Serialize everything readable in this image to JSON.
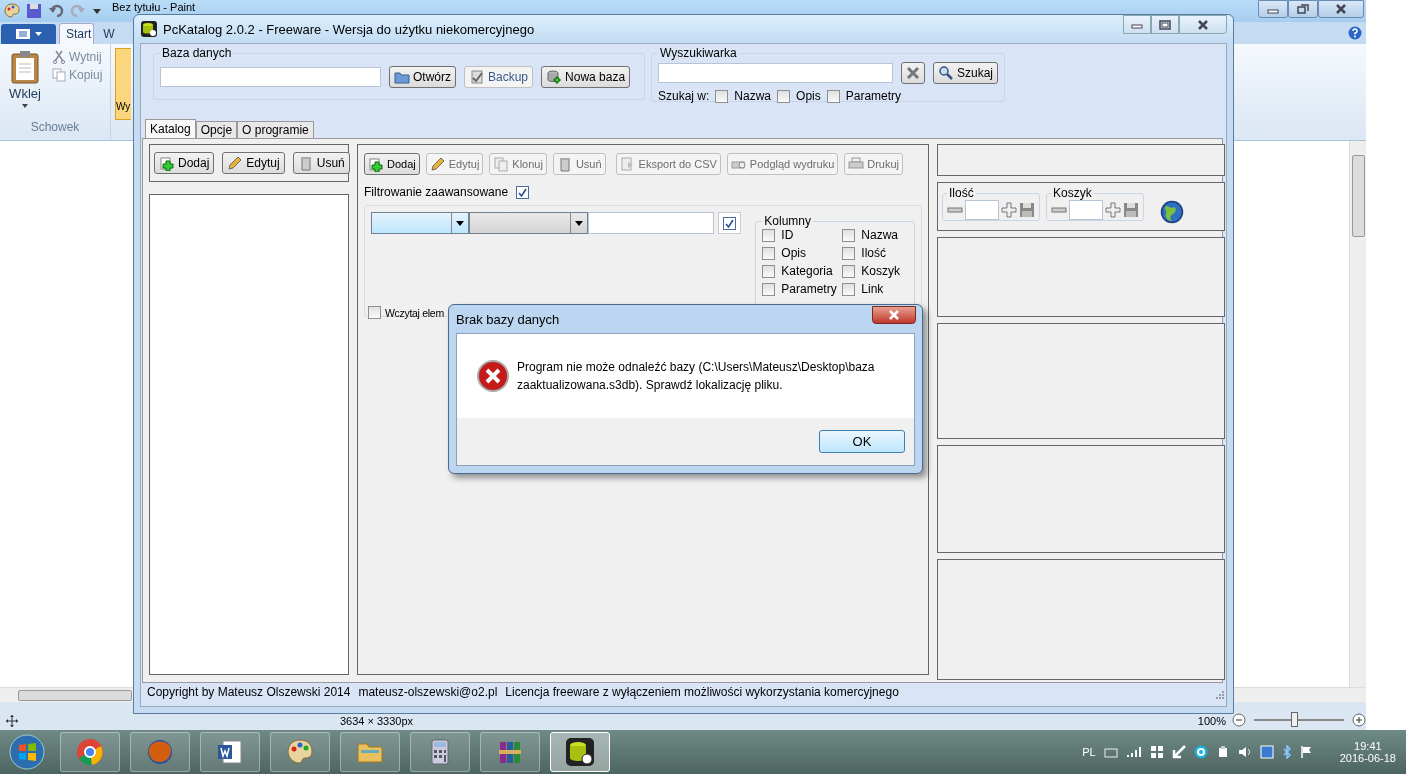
{
  "paint": {
    "title": "Bez tytułu - Paint",
    "tabs": [
      {
        "label": "Start",
        "selected": true
      },
      {
        "label": "W",
        "selected": false
      }
    ],
    "paste": "Wklej",
    "cut": "Wytnij",
    "copy": "Kopiuj",
    "group": "Schowek",
    "select": "Wy",
    "size": "3634 × 3330px",
    "zoom": "100%",
    "zoom_slider": {
      "level": 0.45
    }
  },
  "app": {
    "title": "PcKatalog 2.0.2 - Freeware - Wersja do użytku niekomercyjnego",
    "database": {
      "legend": "Baza danych",
      "buttons": [
        {
          "label": "Otwórz",
          "disabled": false
        },
        {
          "label": "Backup",
          "disabled": true
        },
        {
          "label": "Nowa baza",
          "disabled": false
        }
      ]
    },
    "search": {
      "legend": "Wyszukiwarka",
      "button": "Szukaj",
      "search_in": "Szukaj w:",
      "options": [
        {
          "label": "Nazwa",
          "checked": false
        },
        {
          "label": "Opis",
          "checked": false
        },
        {
          "label": "Parametry",
          "checked": false
        }
      ]
    },
    "tabs": [
      {
        "label": "Katalog",
        "selected": true
      },
      {
        "label": "Opcje",
        "selected": false
      },
      {
        "label": "O programie",
        "selected": false
      }
    ],
    "category_buttons": [
      {
        "label": "Dodaj",
        "disabled": false
      },
      {
        "label": "Edytuj",
        "disabled": false
      },
      {
        "label": "Usuń",
        "disabled": false
      }
    ],
    "item_buttons": [
      {
        "label": "Dodaj",
        "disabled": false
      },
      {
        "label": "Edytuj",
        "disabled": true
      },
      {
        "label": "Klonuj",
        "disabled": true
      },
      {
        "label": "Usuń",
        "disabled": true
      },
      {
        "label": "Eksport do CSV",
        "disabled": true
      },
      {
        "label": "Podgląd wydruku",
        "disabled": true
      },
      {
        "label": "Drukuj",
        "disabled": true
      }
    ],
    "advanced_filter": {
      "label": "Filtrowanie  zaawansowane",
      "checked": true
    },
    "filter_checked": true,
    "columns": {
      "legend": "Kolumny",
      "items": [
        {
          "label": "ID",
          "checked": false
        },
        {
          "label": "Nazwa",
          "checked": false
        },
        {
          "label": "Opis",
          "checked": false
        },
        {
          "label": "Ilość",
          "checked": false
        },
        {
          "label": "Kategoria",
          "checked": false
        },
        {
          "label": "Koszyk",
          "checked": false
        },
        {
          "label": "Parametry",
          "checked": false
        },
        {
          "label": "Link",
          "checked": false
        }
      ]
    },
    "load_elements": {
      "label": "Wczytaj elem",
      "checked": false
    },
    "quantity": {
      "legend": "Ilość"
    },
    "basket": {
      "legend": "Koszyk"
    },
    "status": [
      "Copyright by Mateusz Olszewski 2014",
      "mateusz-olszewski@o2.pl",
      "Licencja freeware z wyłączeniem możliwości wykorzystania komercyjnego"
    ]
  },
  "dialog": {
    "title": "Brak bazy danych",
    "message": "Program nie może odnaleźć bazy (C:\\Users\\Mateusz\\Desktop\\baza zaaktualizowana.s3db). Sprawdź lokalizację pliku.",
    "button": "OK"
  },
  "taskbar": {
    "apps": [
      {
        "kind": "chrome",
        "active": false
      },
      {
        "kind": "firefox",
        "active": false
      },
      {
        "kind": "word",
        "active": false
      },
      {
        "kind": "paint",
        "active": false
      },
      {
        "kind": "explorer",
        "active": false
      },
      {
        "kind": "calculator",
        "active": false
      },
      {
        "kind": "winrar",
        "active": false
      },
      {
        "kind": "pckatalog",
        "active": true
      }
    ],
    "language": "PL",
    "time": "19:41",
    "date": "2016-06-18"
  }
}
